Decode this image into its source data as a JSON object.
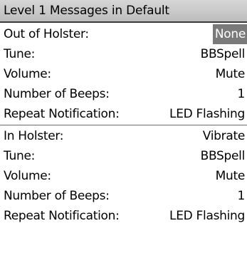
{
  "title": "Level 1 Messages in Default",
  "out_of_holster": {
    "rows": [
      {
        "label": "Out of Holster:",
        "value": "None"
      },
      {
        "label": "Tune:",
        "value": "BBSpell"
      },
      {
        "label": "Volume:",
        "value": "Mute"
      },
      {
        "label": "Number of Beeps:",
        "value": "1"
      },
      {
        "label": "Repeat Notification:",
        "value": "LED Flashing"
      }
    ]
  },
  "in_holster": {
    "rows": [
      {
        "label": "In Holster:",
        "value": "Vibrate"
      },
      {
        "label": "Tune:",
        "value": "BBSpell"
      },
      {
        "label": "Volume:",
        "value": "Mute"
      },
      {
        "label": "Number of Beeps:",
        "value": "1"
      },
      {
        "label": "Repeat Notification:",
        "value": "LED Flashing"
      }
    ]
  },
  "colors": {
    "title_bar": "#c9c9c9",
    "selection": "#7a7a7a",
    "background": "#ffffff"
  }
}
